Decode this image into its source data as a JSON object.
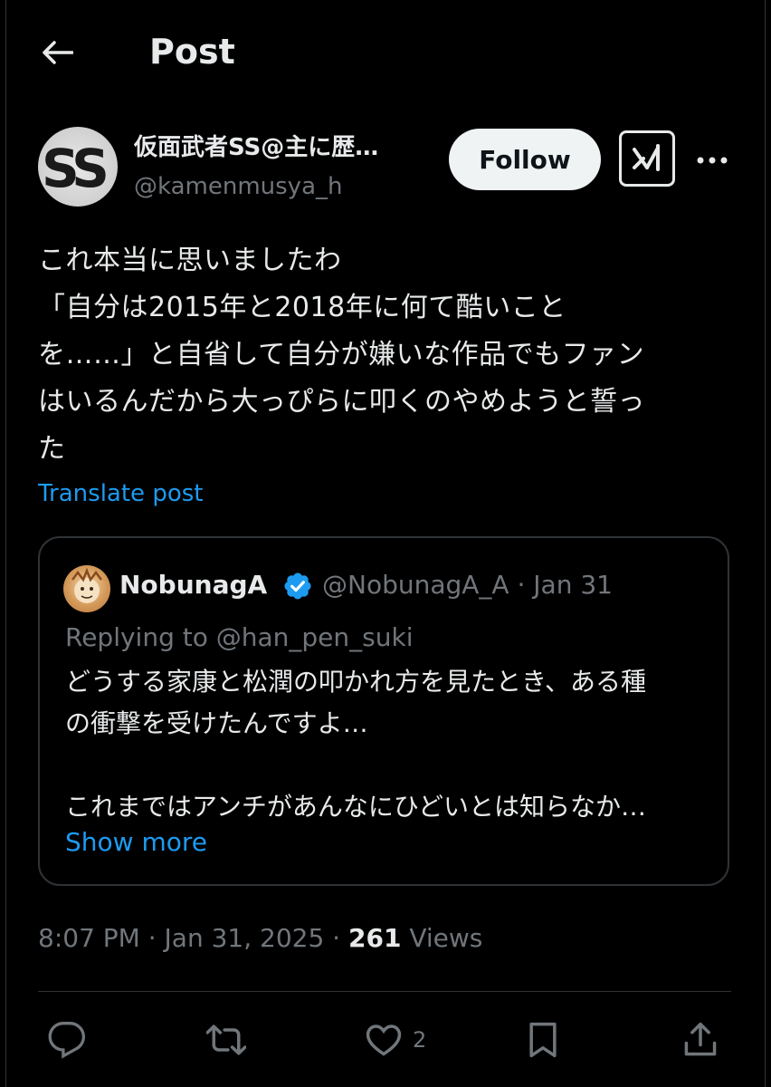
{
  "header": {
    "title": "Post"
  },
  "author": {
    "name": "仮面武者SS@主に歴…",
    "handle": "@kamenmusya_h",
    "follow_label": "Follow"
  },
  "post": {
    "text": "これ本当に思いましたわ\n「自分は2015年と2018年に何て酷いこと\nを……」と自省して自分が嫌いな作品でもファン\nはいるんだから大っぴらに叩くのやめようと誓っ\nた",
    "translate_label": "Translate post"
  },
  "quote": {
    "name": "NobunagA",
    "handle_date": "@NobunagA_A · Jan 31",
    "reply": "Replying to @han_pen_suki",
    "text": "どうする家康と松潤の叩かれ方を見たとき、ある種\nの衝撃を受けたんですよ…\n\nこれまではアンチがあんなにひどいとは知らなか…",
    "show_more": "Show more"
  },
  "meta": {
    "time_date": "8:07 PM · Jan 31, 2025 · ",
    "views_count": "261",
    "views_label": " Views"
  },
  "actions": {
    "likes": "2"
  },
  "colors": {
    "background": "#000000",
    "text": "#e7e9ea",
    "secondary": "#71767b",
    "accent": "#1d9bf0",
    "border": "#2f3336"
  },
  "icons": [
    "back-arrow-icon",
    "grok-icon",
    "more-icon",
    "verified-icon",
    "reply-icon",
    "repost-icon",
    "like-icon",
    "bookmark-icon",
    "share-icon"
  ]
}
